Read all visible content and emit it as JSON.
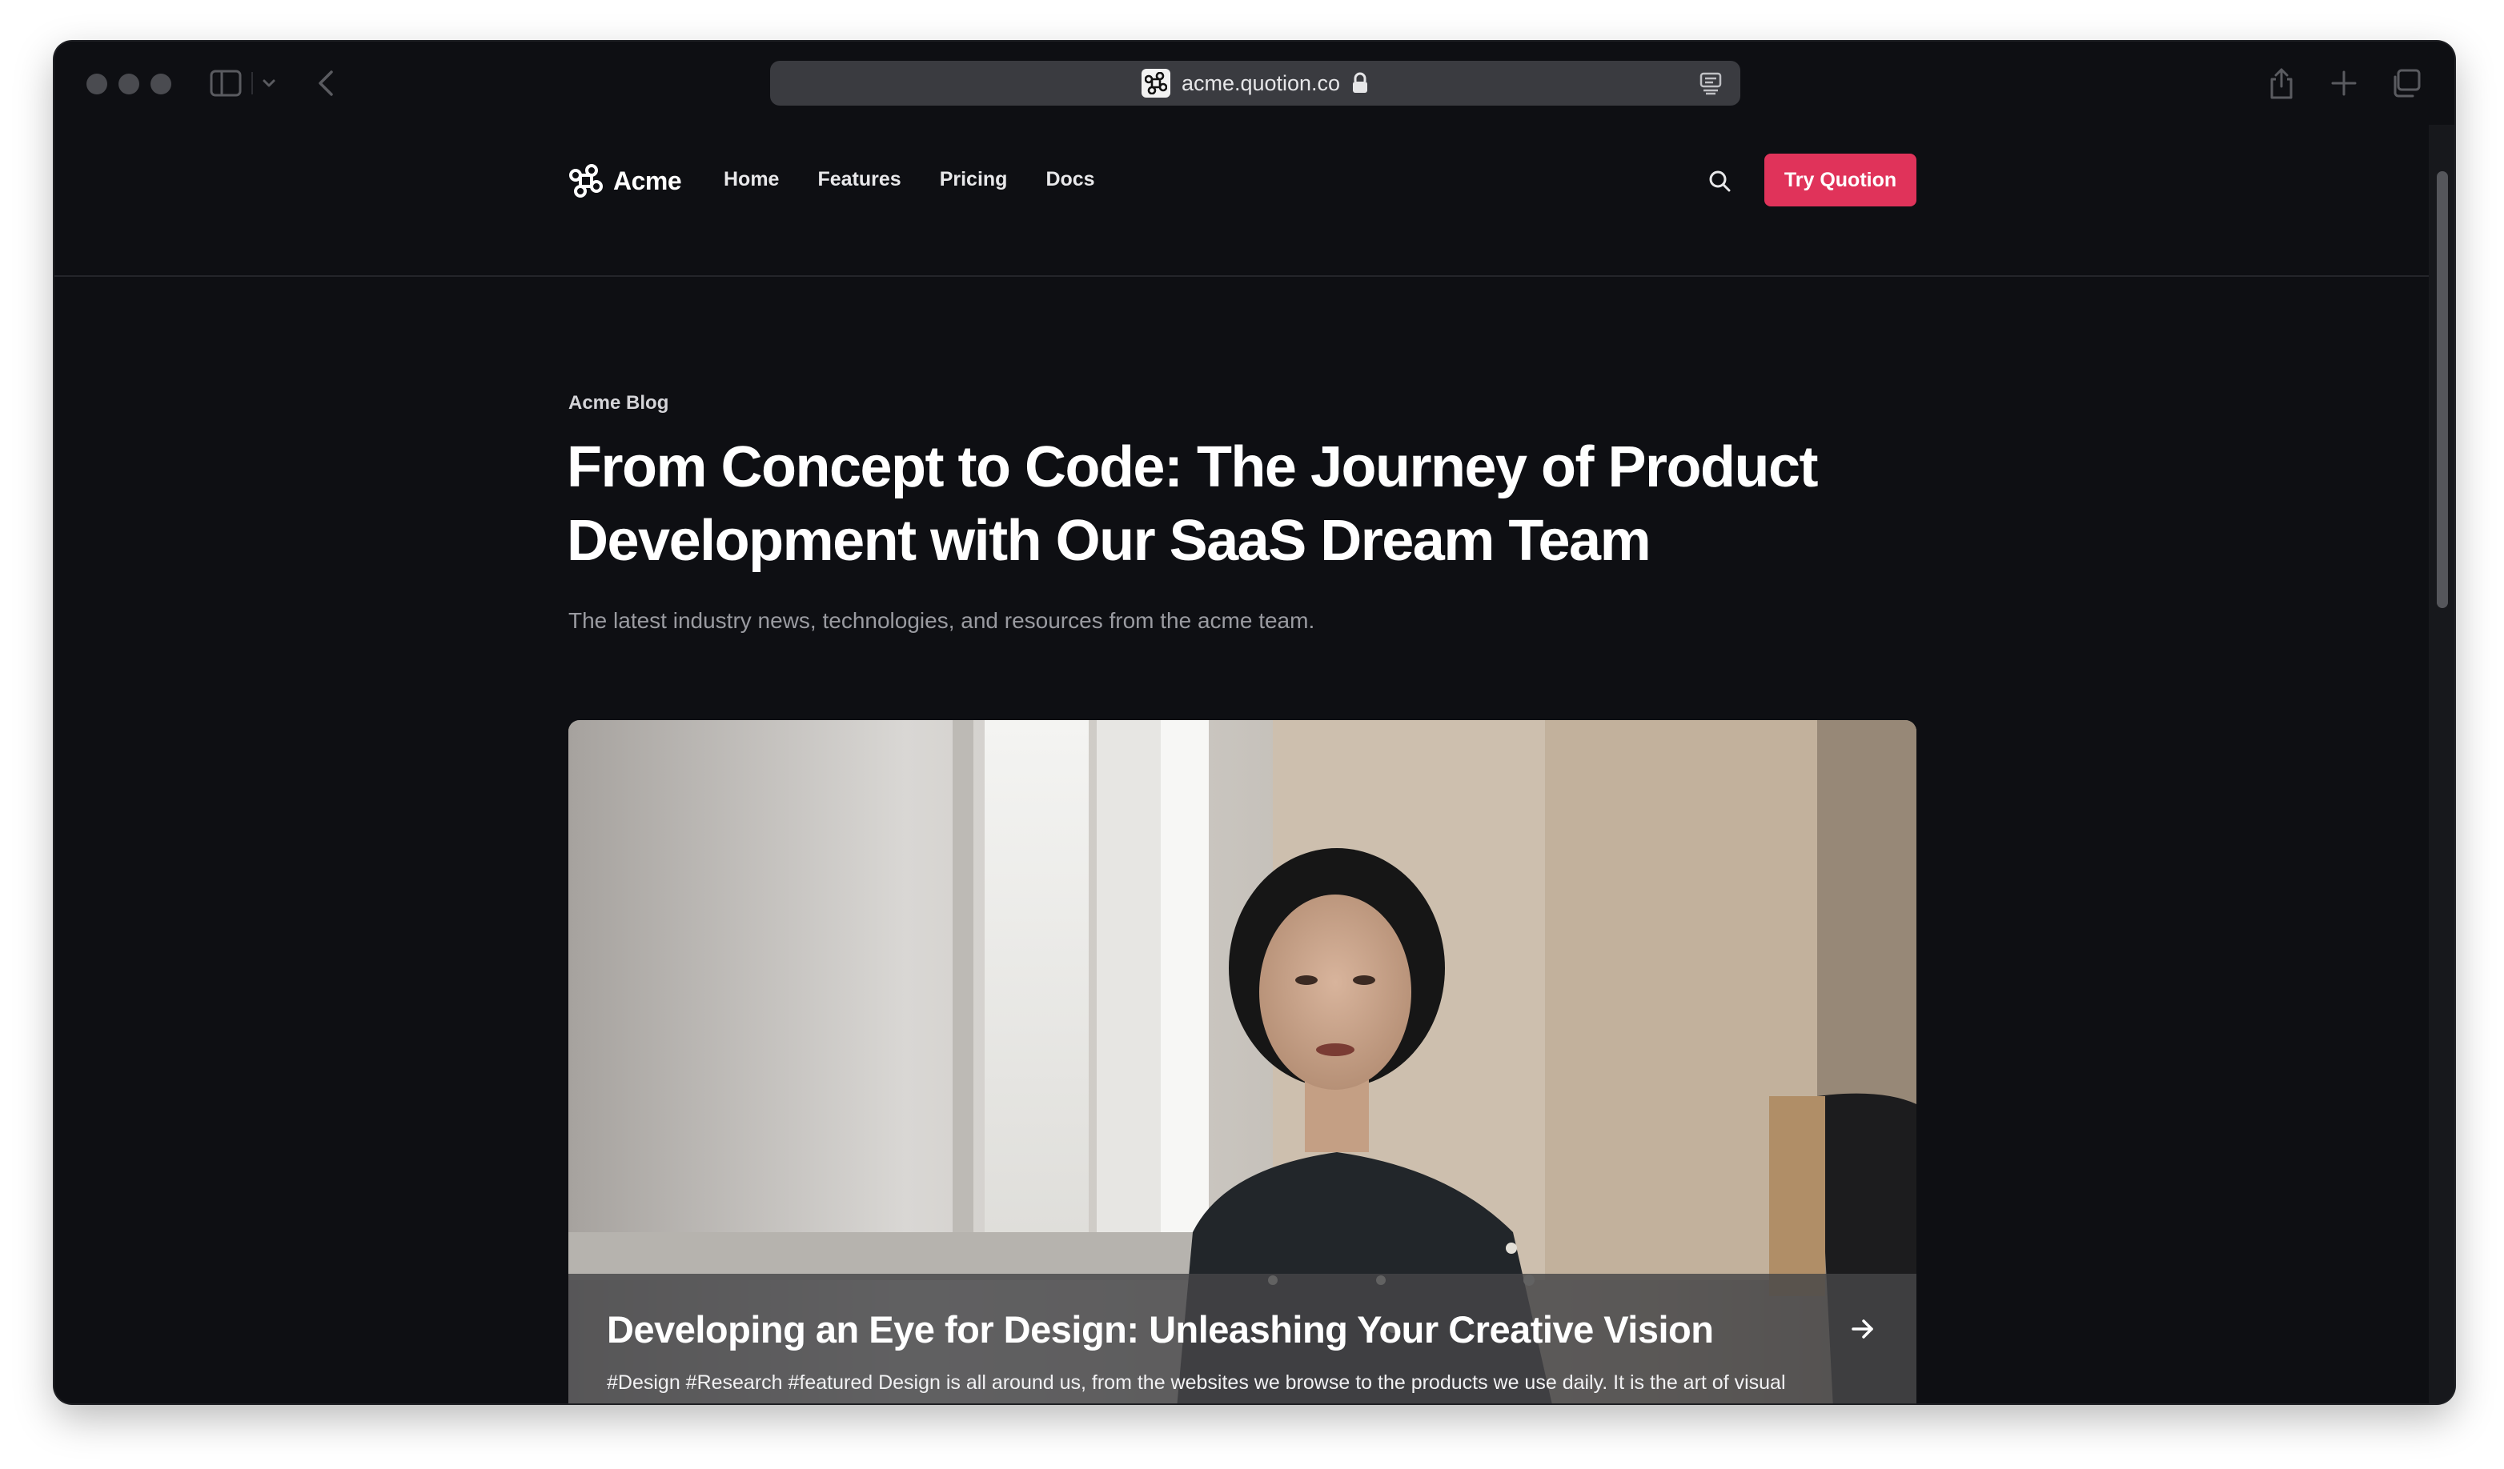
{
  "browser": {
    "url": "acme.quotion.co"
  },
  "nav": {
    "brand": "Acme",
    "links": [
      "Home",
      "Features",
      "Pricing",
      "Docs"
    ],
    "cta": "Try Quotion"
  },
  "hero": {
    "eyebrow": "Acme Blog",
    "title": "From Concept to Code: The Journey of Product Development with Our SaaS Dream Team",
    "subtitle": "The latest industry news, technologies, and resources from the acme team."
  },
  "featured_post": {
    "title": "Developing an Eye for Design: Unleashing Your Creative Vision",
    "excerpt": "#Design #Research #featured Design is all around us, from the websites we browse to the products we use daily. It is the art of visual communication, combining aesthetics and functionality to create captivating experiences. While natural talent plays a role,..."
  },
  "colors": {
    "background": "#0e0f13",
    "accent": "#e0335a"
  }
}
